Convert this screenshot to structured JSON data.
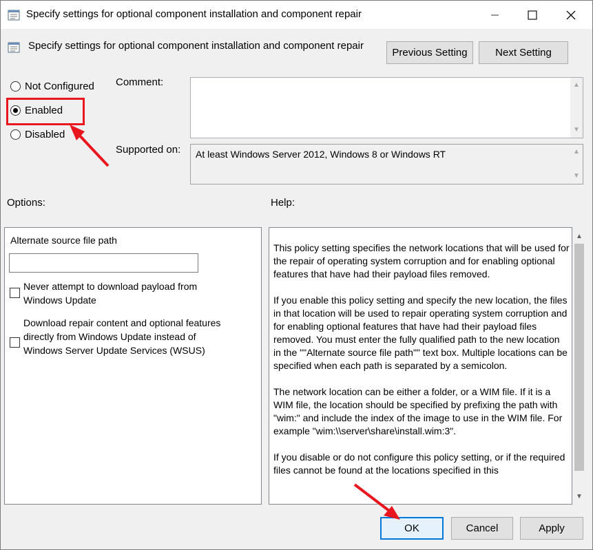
{
  "window": {
    "title": "Specify settings for optional component installation and component repair"
  },
  "header": {
    "policy_name": "Specify settings for optional component installation and component repair",
    "prev_button": "Previous Setting",
    "next_button": "Next Setting"
  },
  "state": {
    "options": [
      "Not Configured",
      "Enabled",
      "Disabled"
    ],
    "selected": "Enabled"
  },
  "comment": {
    "label": "Comment:",
    "value": ""
  },
  "supported": {
    "label": "Supported on:",
    "value": "At least Windows Server 2012, Windows 8 or Windows RT"
  },
  "options_panel": {
    "label": "Options:",
    "alt_path_label": "Alternate source file path",
    "alt_path_value": "",
    "checkbox1": "Never attempt to download payload from Windows Update",
    "checkbox2": "Download repair content and optional features directly from Windows Update instead of Windows Server Update Services (WSUS)",
    "checkbox1_checked": false,
    "checkbox2_checked": false
  },
  "help_panel": {
    "label": "Help:",
    "paragraphs": [
      "This policy setting specifies the network locations that will be used for the repair of operating system corruption and for enabling optional features that have had their payload files removed.",
      "If you enable this policy setting and specify the new location, the files in that location will be used to repair operating system corruption and for enabling optional features that have had their payload files removed. You must enter the fully qualified path to the new location in the \"\"Alternate source file path\"\" text box. Multiple locations can be specified when each path is separated by a semicolon.",
      "The network location can be either a folder, or a WIM file. If it is a WIM file, the location should be specified by prefixing the path with \"wim:\" and include the index of the image to use in the WIM file. For example \"wim:\\\\server\\share\\install.wim:3\".",
      "If you disable or do not configure this policy setting, or if the required files cannot be found at the locations specified in this"
    ]
  },
  "footer": {
    "ok": "OK",
    "cancel": "Cancel",
    "apply": "Apply"
  },
  "colors": {
    "annotation": "#e8171f",
    "accent": "#0078d7"
  }
}
